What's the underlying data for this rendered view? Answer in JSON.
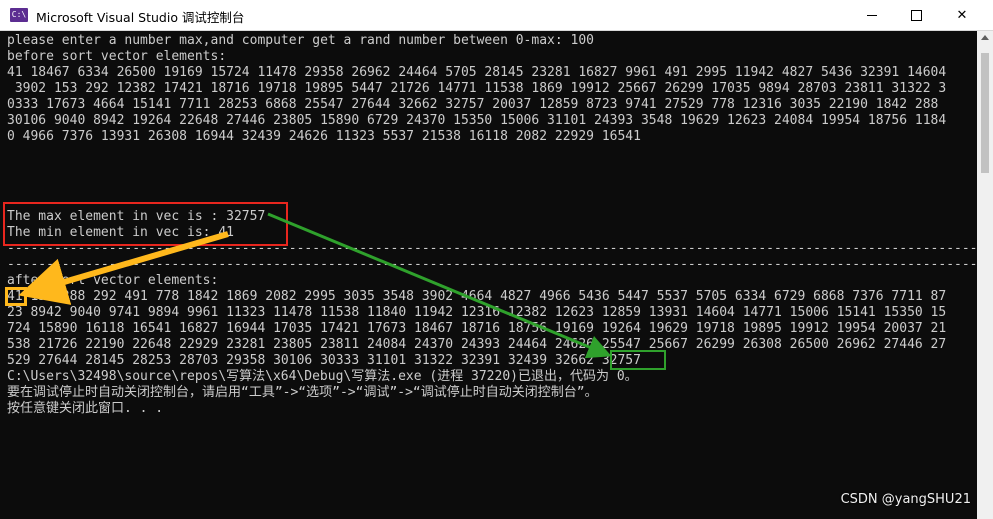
{
  "window": {
    "title": "Microsoft Visual Studio 调试控制台",
    "icon_label": "C:\\",
    "minimize_label": "—",
    "maximize_label": "☐",
    "close_label": "✕"
  },
  "console": {
    "lines": [
      "please enter a number max,and computer get a rand number between 0-max: 100",
      "before sort vector elements:",
      "41 18467 6334 26500 19169 15724 11478 29358 26962 24464 5705 28145 23281 16827 9961 491 2995 11942 4827 5436 32391 14604",
      " 3902 153 292 12382 17421 18716 19718 19895 5447 21726 14771 11538 1869 19912 25667 26299 17035 9894 28703 23811 31322 3",
      "0333 17673 4664 15141 7711 28253 6868 25547 27644 32662 32757 20037 12859 8723 9741 27529 778 12316 3035 22190 1842 288",
      "30106 9040 8942 19264 22648 27446 23805 15890 6729 24370 15350 15006 31101 24393 3548 19629 12623 24084 19954 18756 1184",
      "0 4966 7376 13931 26308 16944 32439 24626 11323 5537 21538 16118 2082 22929 16541",
      "",
      "",
      "",
      "",
      "The max element in vec is : 32757",
      "The min element in vec is: 41",
      "----------------------------------------------------------------------------------------------------------------------------",
      "----------------------------------------------------------------------------------------------------------------------------",
      "after sort vector elements:",
      "41 153 288 292 491 778 1842 1869 2082 2995 3035 3548 3902 4664 4827 4966 5436 5447 5537 5705 6334 6729 6868 7376 7711 87",
      "23 8942 9040 9741 9894 9961 11323 11478 11538 11840 11942 12316 12382 12623 12859 13931 14604 14771 15006 15141 15350 15",
      "724 15890 16118 16541 16827 16944 17035 17421 17673 18467 18716 18756 19169 19264 19629 19718 19895 19912 19954 20037 21",
      "538 21726 22190 22648 22929 23281 23805 23811 24084 24370 24393 24464 24626 25547 25667 26299 26308 26500 26962 27446 27",
      "529 27644 28145 28253 28703 29358 30106 30333 31101 31322 32391 32439 32662 32757",
      "C:\\Users\\32498\\source\\repos\\写算法\\x64\\Debug\\写算法.exe (进程 37220)已退出，代码为 0。",
      "要在调试停止时自动关闭控制台，请启用“工具”->“选项”->“调试”->“调试停止时自动关闭控制台”。",
      "按任意键关闭此窗口. . ."
    ]
  },
  "watermark": "CSDN @yangSHU21",
  "colors": {
    "console_bg": "#0c0c0c",
    "console_text": "#cccccc",
    "red_box": "#e8261e",
    "orange_box": "#ffb81c",
    "green_box": "#2fa12c",
    "titlebar_bg": "#ffffff"
  }
}
